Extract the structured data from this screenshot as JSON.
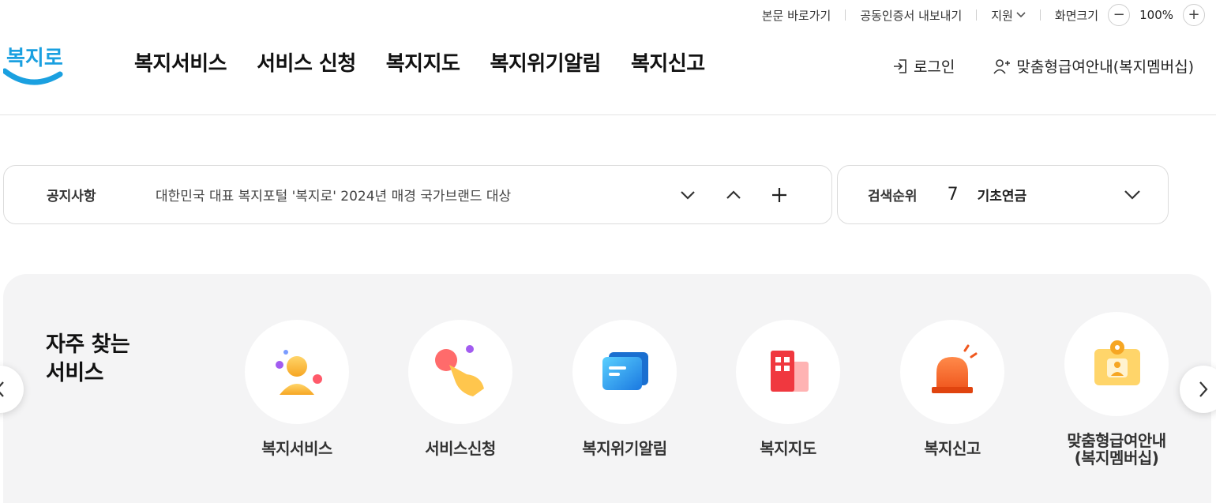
{
  "util_bar": {
    "skip_link": "본문 바로가기",
    "cert_export": "공동인증서 내보내기",
    "support": "지원",
    "zoom_label": "화면크기",
    "zoom_out": "−",
    "zoom_value": "100%",
    "zoom_in": "+"
  },
  "header": {
    "logo_text": "복지로",
    "nav": [
      "복지서비스",
      "서비스 신청",
      "복지지도",
      "복지위기알림",
      "복지신고"
    ],
    "login": "로그인",
    "membership": "맞춤형급여안내(복지멤버십)"
  },
  "notice": {
    "title": "공지사항",
    "message": "대한민국 대표 복지포털 '복지로' 2024년 매경 국가브랜드 대상"
  },
  "search_rank": {
    "title": "검색순위",
    "rank": "7",
    "keyword": "기초연금"
  },
  "frequent": {
    "title_line1": "자주 찾는",
    "title_line2": "서비스",
    "items": [
      {
        "label": "복지서비스",
        "icon": "person-icon"
      },
      {
        "label": "서비스신청",
        "icon": "tap-hand-icon"
      },
      {
        "label": "복지위기알림",
        "icon": "message-icon"
      },
      {
        "label": "복지지도",
        "icon": "building-icon"
      },
      {
        "label": "복지신고",
        "icon": "siren-icon"
      },
      {
        "label": "맞춤형급여안내\n(복지멤버십)",
        "icon": "membership-card-icon"
      }
    ]
  },
  "colors": {
    "brand_blue": "#1aa0e0",
    "panel_bg": "#f4f4f5"
  }
}
